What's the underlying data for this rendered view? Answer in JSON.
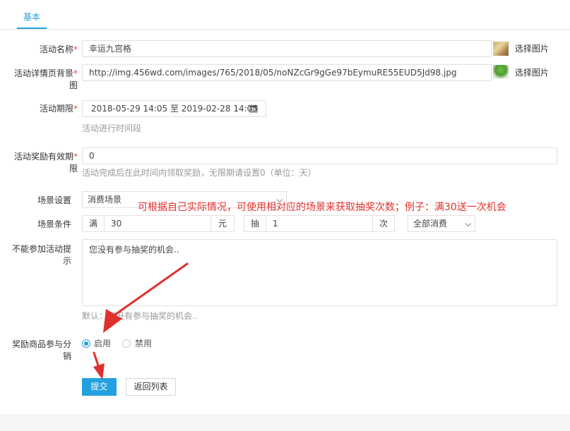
{
  "tabs": [
    {
      "label": "基本"
    }
  ],
  "required_mark": "*",
  "form": {
    "activity_name": {
      "label": "活动名称",
      "value": "幸运九宫格",
      "pick_label": "选择图片"
    },
    "detail_bg": {
      "label_line1": "活动详情页背景",
      "label_line2": "图",
      "value": "http://img.456wd.com/images/765/2018/05/noNZcGr9gGe97bEymuRE55EUD5Jd98.jpg",
      "pick_label": "选择图片"
    },
    "period": {
      "label": "活动期限",
      "value": "2018-05-29 14:05 至 2019-02-28 14:05",
      "help": "活动进行时间段"
    },
    "reward_valid": {
      "label_line1": "活动奖励有效期",
      "label_line2": "限",
      "value": "0",
      "help": "活动完成后在此时间内领取奖励，无限期请设置0（单位：天）"
    },
    "scene": {
      "label": "场景设置",
      "selected": "消费场景"
    },
    "condition": {
      "label": "场景条件",
      "prefix": "满",
      "amount": "30",
      "unit": "元",
      "draw_prefix": "抽",
      "draw_count": "1",
      "draw_unit": "次",
      "scope": "全部消费"
    },
    "no_join_tip": {
      "label_line1": "不能参加活动提",
      "label_line2": "示",
      "value": "您没有参与抽奖的机会..",
      "help": "默认：您没有参与抽奖的机会.."
    },
    "distribution": {
      "label_line1": "奖励商品参与分",
      "label_line2": "销",
      "option_on": "启用",
      "option_off": "禁用",
      "selected": "启用"
    }
  },
  "actions": {
    "submit": "提交",
    "back": "返回列表"
  },
  "annotation": "可根据自己实际情况，可使用相对应的场景来获取抽奖次数；例子：满30送一次机会",
  "colors": {
    "accent": "#23a0e0",
    "required": "#e84c3d",
    "annotation": "#e0302d"
  },
  "icons": {
    "calendar": "calendar-icon"
  }
}
